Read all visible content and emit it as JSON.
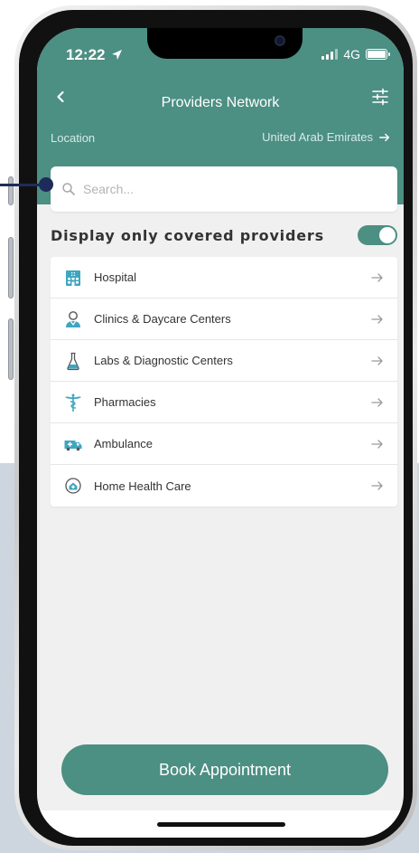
{
  "status_bar": {
    "time": "12:22",
    "network": "4G"
  },
  "header": {
    "title": "Providers Network",
    "location_label": "Location",
    "location_value": "United Arab Emirates"
  },
  "search": {
    "placeholder": "Search..."
  },
  "covered_toggle": {
    "label": "Display only covered providers",
    "enabled": true
  },
  "categories": [
    {
      "label": "Hospital",
      "icon": "hospital-icon"
    },
    {
      "label": "Clinics & Daycare Centers",
      "icon": "doctor-icon"
    },
    {
      "label": "Labs & Diagnostic Centers",
      "icon": "flask-icon"
    },
    {
      "label": "Pharmacies",
      "icon": "caduceus-icon"
    },
    {
      "label": "Ambulance",
      "icon": "ambulance-icon"
    },
    {
      "label": "Home Health Care",
      "icon": "home-care-icon"
    }
  ],
  "book_button": {
    "label": "Book Appointment"
  },
  "colors": {
    "primary": "#4c8f83",
    "icon_accent": "#3fa6c0",
    "connector": "#1e2b5a"
  }
}
